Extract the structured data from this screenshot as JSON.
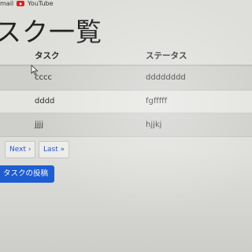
{
  "bookmarks": {
    "gmail_label": "mail",
    "youtube_label": "YouTube"
  },
  "page": {
    "title": "スク一覧"
  },
  "table": {
    "headers": [
      "タスク",
      "ステータス"
    ],
    "rows": [
      {
        "task": "cccc",
        "status": "dddddddd"
      },
      {
        "task": "dddd",
        "status": "fgfffff"
      },
      {
        "task": "jjjj",
        "status": "hjjkj"
      }
    ]
  },
  "pagination": {
    "next_label": "Next ›",
    "last_label": "Last »"
  },
  "actions": {
    "post_label": "タスクの投稿"
  },
  "colors": {
    "accent": "#1f5ed6",
    "link": "#2455c4",
    "youtube_red": "#e02020"
  },
  "icons": [
    "youtube-icon",
    "mouse-cursor-icon"
  ]
}
